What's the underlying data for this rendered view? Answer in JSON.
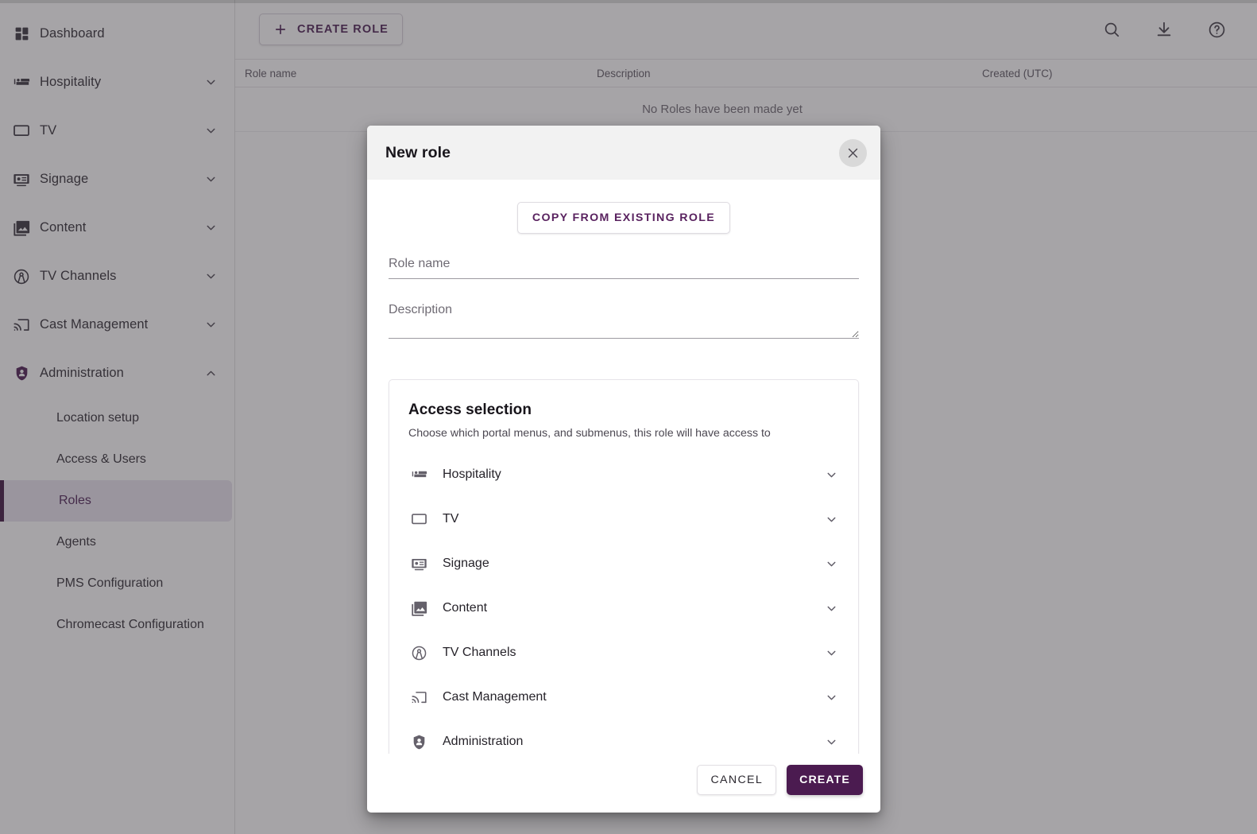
{
  "sidebar": {
    "items": [
      {
        "label": "Dashboard",
        "icon": "dashboard-icon",
        "expandable": false
      },
      {
        "label": "Hospitality",
        "icon": "bed-icon",
        "expandable": true,
        "expanded": false
      },
      {
        "label": "TV",
        "icon": "monitor-icon",
        "expandable": true,
        "expanded": false
      },
      {
        "label": "Signage",
        "icon": "signage-icon",
        "expandable": true,
        "expanded": false
      },
      {
        "label": "Content",
        "icon": "photo-library-icon",
        "expandable": true,
        "expanded": false
      },
      {
        "label": "TV Channels",
        "icon": "broadcast-tower-icon",
        "expandable": true,
        "expanded": false
      },
      {
        "label": "Cast Management",
        "icon": "cast-icon",
        "expandable": true,
        "expanded": false
      },
      {
        "label": "Administration",
        "icon": "shield-person-icon",
        "expandable": true,
        "expanded": true
      }
    ],
    "sub_items": [
      {
        "label": "Location setup",
        "active": false
      },
      {
        "label": "Access & Users",
        "active": false
      },
      {
        "label": "Roles",
        "active": true
      },
      {
        "label": "Agents",
        "active": false
      },
      {
        "label": "PMS Configuration",
        "active": false
      },
      {
        "label": "Chromecast Configuration",
        "active": false
      }
    ],
    "active_accent_color": "#3d1340",
    "active_bg_color": "#e9e3ef"
  },
  "toolbar": {
    "create_role_label": "CREATE ROLE",
    "create_role_icon": "plus-icon",
    "icons": [
      {
        "name": "search-icon"
      },
      {
        "name": "download-icon"
      },
      {
        "name": "help-circle-icon"
      }
    ]
  },
  "table": {
    "columns": [
      "Role name",
      "Description",
      "Created (UTC)"
    ],
    "empty_message": "No Roles have been made yet",
    "rows": []
  },
  "dialog": {
    "title": "New role",
    "close_icon": "close-icon",
    "copy_button_label": "COPY FROM EXISTING ROLE",
    "role_name": {
      "placeholder": "Role name",
      "value": ""
    },
    "description": {
      "placeholder": "Description",
      "value": ""
    },
    "access": {
      "title": "Access selection",
      "subtitle": "Choose which portal menus, and submenus, this role will have access to",
      "rows": [
        {
          "label": "Hospitality",
          "icon": "bed-icon"
        },
        {
          "label": "TV",
          "icon": "monitor-icon"
        },
        {
          "label": "Signage",
          "icon": "signage-icon"
        },
        {
          "label": "Content",
          "icon": "photo-library-icon"
        },
        {
          "label": "TV Channels",
          "icon": "broadcast-tower-icon"
        },
        {
          "label": "Cast Management",
          "icon": "cast-icon"
        },
        {
          "label": "Administration",
          "icon": "shield-person-icon"
        }
      ]
    },
    "cancel_label": "CANCEL",
    "create_label": "CREATE",
    "primary_color": "#4b1b50"
  }
}
